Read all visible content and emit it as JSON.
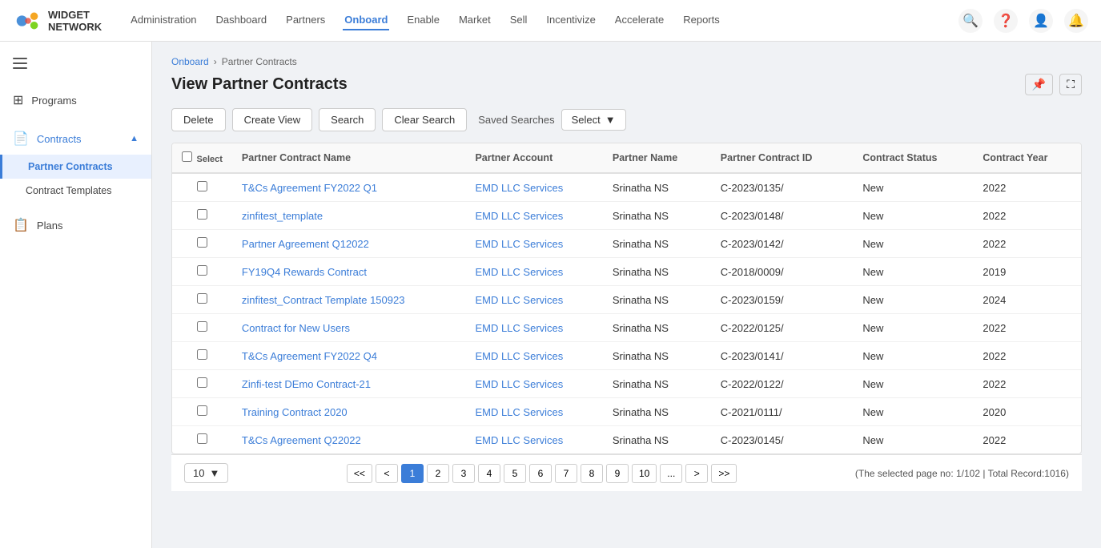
{
  "app": {
    "logo_text": "WIDGET NETWORK"
  },
  "top_nav": {
    "links": [
      {
        "label": "Administration",
        "active": false
      },
      {
        "label": "Dashboard",
        "active": false
      },
      {
        "label": "Partners",
        "active": false
      },
      {
        "label": "Onboard",
        "active": true
      },
      {
        "label": "Enable",
        "active": false
      },
      {
        "label": "Market",
        "active": false
      },
      {
        "label": "Sell",
        "active": false
      },
      {
        "label": "Incentivize",
        "active": false
      },
      {
        "label": "Accelerate",
        "active": false
      },
      {
        "label": "Reports",
        "active": false
      }
    ]
  },
  "sidebar": {
    "programs_label": "Programs",
    "contracts_label": "Contracts",
    "partner_contracts_label": "Partner Contracts",
    "contract_templates_label": "Contract Templates",
    "plans_label": "Plans"
  },
  "breadcrumb": {
    "onboard": "Onboard",
    "separator": "›",
    "current": "Partner Contracts"
  },
  "page": {
    "title": "View Partner Contracts"
  },
  "toolbar": {
    "delete_label": "Delete",
    "create_view_label": "Create View",
    "search_label": "Search",
    "clear_search_label": "Clear Search",
    "saved_searches_label": "Saved Searches",
    "select_label": "Select"
  },
  "table": {
    "headers": [
      "Partner Contract Name",
      "Partner Account",
      "Partner Name",
      "Partner Contract ID",
      "Contract Status",
      "Contract Year"
    ],
    "rows": [
      {
        "name": "T&Cs Agreement FY2022 Q1",
        "account": "EMD LLC Services",
        "partner": "Srinatha NS",
        "contract_id": "C-2023/0135/",
        "status": "New",
        "year": "2022"
      },
      {
        "name": "zinfitest_template",
        "account": "EMD LLC Services",
        "partner": "Srinatha NS",
        "contract_id": "C-2023/0148/",
        "status": "New",
        "year": "2022"
      },
      {
        "name": "Partner Agreement Q12022",
        "account": "EMD LLC Services",
        "partner": "Srinatha NS",
        "contract_id": "C-2023/0142/",
        "status": "New",
        "year": "2022"
      },
      {
        "name": "FY19Q4 Rewards Contract",
        "account": "EMD LLC Services",
        "partner": "Srinatha NS",
        "contract_id": "C-2018/0009/",
        "status": "New",
        "year": "2019"
      },
      {
        "name": "zinfitest_Contract Template 150923",
        "account": "EMD LLC Services",
        "partner": "Srinatha NS",
        "contract_id": "C-2023/0159/",
        "status": "New",
        "year": "2024"
      },
      {
        "name": "Contract for New Users",
        "account": "EMD LLC Services",
        "partner": "Srinatha NS",
        "contract_id": "C-2022/0125/",
        "status": "New",
        "year": "2022"
      },
      {
        "name": "T&Cs Agreement FY2022 Q4",
        "account": "EMD LLC Services",
        "partner": "Srinatha NS",
        "contract_id": "C-2023/0141/",
        "status": "New",
        "year": "2022"
      },
      {
        "name": "Zinfi-test DEmo Contract-21",
        "account": "EMD LLC Services",
        "partner": "Srinatha NS",
        "contract_id": "C-2022/0122/",
        "status": "New",
        "year": "2022"
      },
      {
        "name": "Training Contract 2020",
        "account": "EMD LLC Services",
        "partner": "Srinatha NS",
        "contract_id": "C-2021/0111/",
        "status": "New",
        "year": "2020"
      },
      {
        "name": "T&Cs Agreement Q22022",
        "account": "EMD LLC Services",
        "partner": "Srinatha NS",
        "contract_id": "C-2023/0145/",
        "status": "New",
        "year": "2022"
      }
    ]
  },
  "pagination": {
    "per_page": "10",
    "pages": [
      "<<",
      "<",
      "1",
      "2",
      "3",
      "4",
      "5",
      "6",
      "7",
      "8",
      "9",
      "10",
      "...",
      ">",
      ">>"
    ],
    "active_page": "1",
    "info": "(The selected page no: 1/102 | Total Record:1016)"
  }
}
